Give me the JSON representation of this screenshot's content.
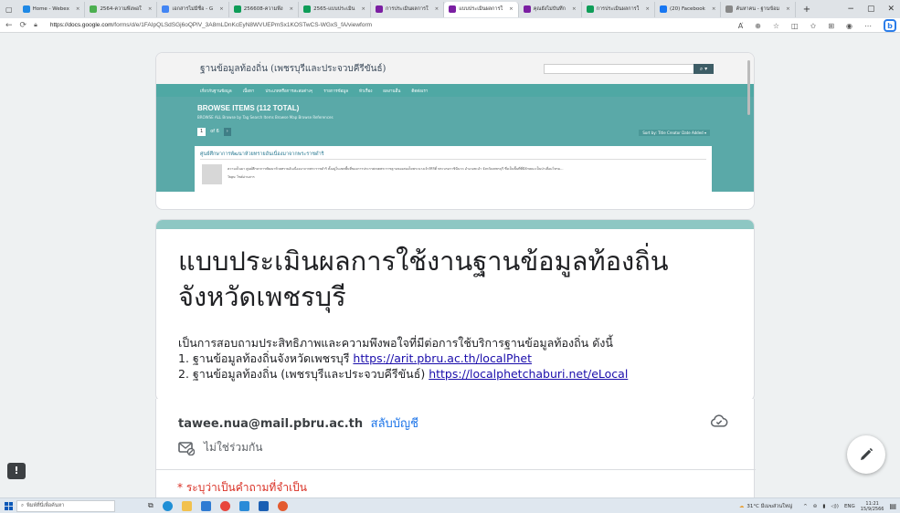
{
  "browser": {
    "tabs": [
      {
        "label": "Home - Webex",
        "color": "#1e88e5"
      },
      {
        "label": "2564-ความพึงพอใ",
        "color": "#4caf50"
      },
      {
        "label": "เอกสารไม่มีชื่อ - G",
        "color": "#4285f4"
      },
      {
        "label": "256608-ความพึง",
        "color": "#0f9d58"
      },
      {
        "label": "2565-แบบประเมิน",
        "color": "#0f9d58"
      },
      {
        "label": "การประเมินผลการใ",
        "color": "#7b1fa2"
      },
      {
        "label": "แบบประเมินผลการใ",
        "color": "#7b1fa2",
        "active": true
      },
      {
        "label": "คุณยังไม่บันทึก",
        "color": "#7b1fa2"
      },
      {
        "label": "การประเมินผลการใ",
        "color": "#0f9d58"
      },
      {
        "label": "(20) Facebook",
        "color": "#1877f2"
      },
      {
        "label": "ค้นหาคน - ฐานข้อม",
        "color": "#888888"
      }
    ],
    "new_tab": "+",
    "url_host": "https://docs.google.com",
    "url_path": "/forms/d/e/1FAIpQLSdSGj6oQPlV_3A8mLDnKcEyN8WVUEPmSx1KOSTwCS-WGxS_fA/viewform",
    "window_controls": [
      "−",
      "▢",
      "✕"
    ]
  },
  "banner": {
    "site_title": "ฐานข้อมูลท้องถิ่น (เพชรบุรีและประจวบคีรีขันธ์)",
    "nav": [
      "เกี่ยวกับฐานข้อมูล",
      "เนื้อหา",
      "ประเภทหรือการสะสมต่างๆ",
      "รายการข้อมูล",
      "หัวเรื่อง",
      "ผลงานอื่น",
      "ติดต่อเรา"
    ],
    "heading": "BROWSE ITEMS (112 TOTAL)",
    "sub": "BROWSE ALL   Browse by Tag   Search Items   Browse Map   Browse References",
    "pager_page": "1",
    "pager_of": "of 6",
    "sort": "Sort by:  Title  Creator  Date Added ▾",
    "item_title": "ศูนย์ศึกษาการพัฒนาห้วยทรายอันเนื่องมาจากพระราชดำริ",
    "item_desc": "ความเป็นมา   ศูนย์ศึกษาการพัฒนาห้วยทรายอันเนื่องมาจากพระราชดำริ ตั้งอยู่ในเขตพื้นที่ของการประกาศเขตพระราชฐานของสมเด็จพระนางเจ้าสิริกิติ์ พระบรมราชินีนาถ อำเภอชะอำ จังหวัดเพชรบุรี ซึ่งเป็นพื้นที่ที่มีลักษณะเป็นป่าเสื่อมโทรม...",
    "item_tags": "Tags: ไซต์อ่านสาร"
  },
  "form": {
    "title": "แบบประเมินผลการใช้งานฐานข้อมูลท้องถิ่น จังหวัดเพชรบุรี",
    "desc_line1": "เป็นการสอบถามประสิทธิภาพและความพึงพอใจที่มีต่อการใช้บริการฐานข้อมูลท้องถิ่น ดังนี้",
    "desc_line2_text": "1. ฐานข้อมูลท้องถิ่นจังหวัดเพชรบุรี ",
    "desc_line2_link": "https://arit.pbru.ac.th/localPhet",
    "desc_line3_text": "2. ฐานข้อมูลท้องถิ่น (เพชรบุรีและประจวบคีรีขันธ์) ",
    "desc_line3_link": "https://localphetchaburi.net/eLocal",
    "account_email": "tawee.nua@mail.pbru.ac.th",
    "switch_account": "สลับบัญชี",
    "not_shared": "ไม่ใช่ร่วมกัน",
    "required_note": "* ระบุว่าเป็นคำถามที่จำเป็น"
  },
  "taskbar": {
    "search_placeholder": "พิมพ์ที่นี่เพื่อค้นหา",
    "weather": "31°C มีเมฆส่วนใหญ่",
    "lang": "ENG",
    "time": "11:21",
    "date": "15/9/2566"
  },
  "colors": {
    "accent_teal": "#8dc7c3",
    "link": "#1a0dab",
    "required_red": "#d93025",
    "switch_blue": "#1a73e8"
  }
}
